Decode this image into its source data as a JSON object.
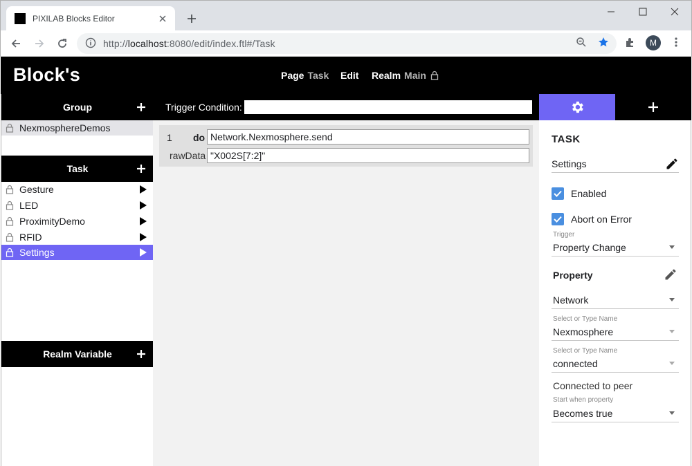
{
  "browser": {
    "tab_title": "PIXILAB Blocks Editor",
    "url_prefix": "http://",
    "url_host": "localhost",
    "url_rest": ":8080/edit/index.ftl#/Task",
    "profile_initial": "M"
  },
  "header": {
    "logo": "Block's",
    "page_label": "Page",
    "page_value": "Task",
    "edit_label": "Edit",
    "realm_label": "Realm",
    "realm_value": "Main"
  },
  "sidebar": {
    "group_title": "Group",
    "groups": [
      {
        "label": "NexmosphereDemos"
      }
    ],
    "task_title": "Task",
    "tasks": [
      {
        "label": "Gesture"
      },
      {
        "label": "LED"
      },
      {
        "label": "ProximityDemo"
      },
      {
        "label": "RFID"
      },
      {
        "label": "Settings"
      }
    ],
    "realm_variable_title": "Realm Variable"
  },
  "trigger": {
    "label": "Trigger Condition:",
    "value": ""
  },
  "block": {
    "line_number": "1",
    "keyword": "do",
    "function": "Network.Nexmosphere.send",
    "param_label": "rawData",
    "param_value": "\"X002S[7:2]\""
  },
  "panel": {
    "title": "TASK",
    "name_value": "Settings",
    "enabled_label": "Enabled",
    "abort_label": "Abort on Error",
    "trigger_caption": "Trigger",
    "trigger_value": "Property Change",
    "property_heading": "Property",
    "property_root": "Network",
    "select_caption_1": "Select or Type Name",
    "property_device": "Nexmosphere",
    "select_caption_2": "Select or Type Name",
    "property_prop": "connected",
    "property_desc": "Connected to peer",
    "start_caption": "Start when property",
    "start_value": "Becomes true"
  },
  "colors": {
    "accent": "#6f65f4",
    "checkbox": "#4a8fe0",
    "header_bg": "#000000",
    "canvas_bg": "#f2f2f2"
  }
}
